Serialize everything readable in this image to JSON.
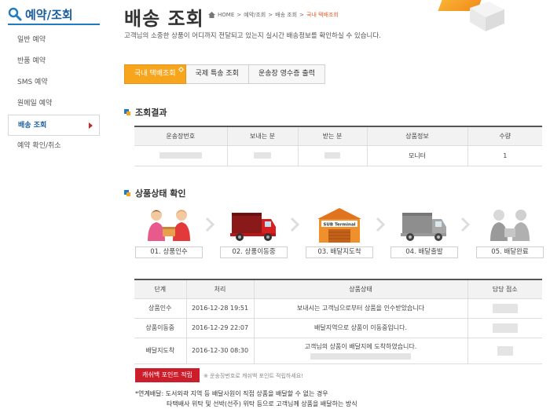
{
  "sidebar": {
    "title": "예약/조회",
    "items": [
      {
        "label": "일반 예약"
      },
      {
        "label": "반품 예약"
      },
      {
        "label": "SMS 예약"
      },
      {
        "label": "원메일 예약"
      },
      {
        "label": "배송 조회"
      },
      {
        "label": "예약 확인/취소"
      }
    ]
  },
  "header": {
    "title": "배송 조회",
    "breadcrumb": [
      "HOME",
      "예약/조회",
      "배송 조회",
      "국내 택배조회"
    ],
    "description": "고객님의 소중한 상품이 어디까지 전달되고 있는지 실시간 배송정보를 확인하실 수 있습니다."
  },
  "tabs": [
    {
      "label": "국내 택배조회",
      "active": true
    },
    {
      "label": "국제 특송 조회",
      "active": false
    },
    {
      "label": "운송장 영수증 출력",
      "active": false
    }
  ],
  "result": {
    "title": "조회결과",
    "columns": [
      "운송장번호",
      "보내는 분",
      "받는 분",
      "상품정보",
      "수량"
    ],
    "row": {
      "product": "모니터",
      "qty": "1"
    }
  },
  "status": {
    "title": "상품상태 확인",
    "steps": [
      {
        "label": "01. 상품인수",
        "icon": "handover-people-icon"
      },
      {
        "label": "02. 상품이동중",
        "icon": "red-truck-icon"
      },
      {
        "label": "03. 배달지도착",
        "icon": "sub-terminal-icon"
      },
      {
        "label": "04. 배달출발",
        "icon": "gray-truck-icon"
      },
      {
        "label": "05. 배달완료",
        "icon": "delivered-people-icon"
      }
    ],
    "terminal_sign": "SUB Terminal",
    "columns": [
      "단계",
      "처리",
      "상품상태",
      "담당 점소"
    ],
    "rows": [
      {
        "stage": "상품인수",
        "time": "2016-12-28 19:51",
        "state": "보내시는 고객님으로부터 상품을 인수받았습니다"
      },
      {
        "stage": "상품이동중",
        "time": "2016-12-29 22:07",
        "state": "배달지역으로 상품이 이동중입니다."
      },
      {
        "stage": "배달지도착",
        "time": "2016-12-30 08:30",
        "state": "고객님의 상품이 배달지에 도착하였습니다."
      }
    ]
  },
  "cashback": {
    "button": "캐쉬백 포인트 적립",
    "note": "※ 운송장번호로 캐쉬백 포인트 적립하세요!"
  },
  "footnotes": {
    "line1": "*연계배달: 도서외곽 지역 등 배달사원이 직접 상품을 배달할 수 없는 경우",
    "line2": "타택배사 위탁 및 선박(선주) 위탁 등으로 고객님께 상품을 배달하는 방식"
  },
  "colors": {
    "accent": "#f7a51c",
    "primary": "#1f7bc2",
    "red": "#cc1d2a"
  }
}
